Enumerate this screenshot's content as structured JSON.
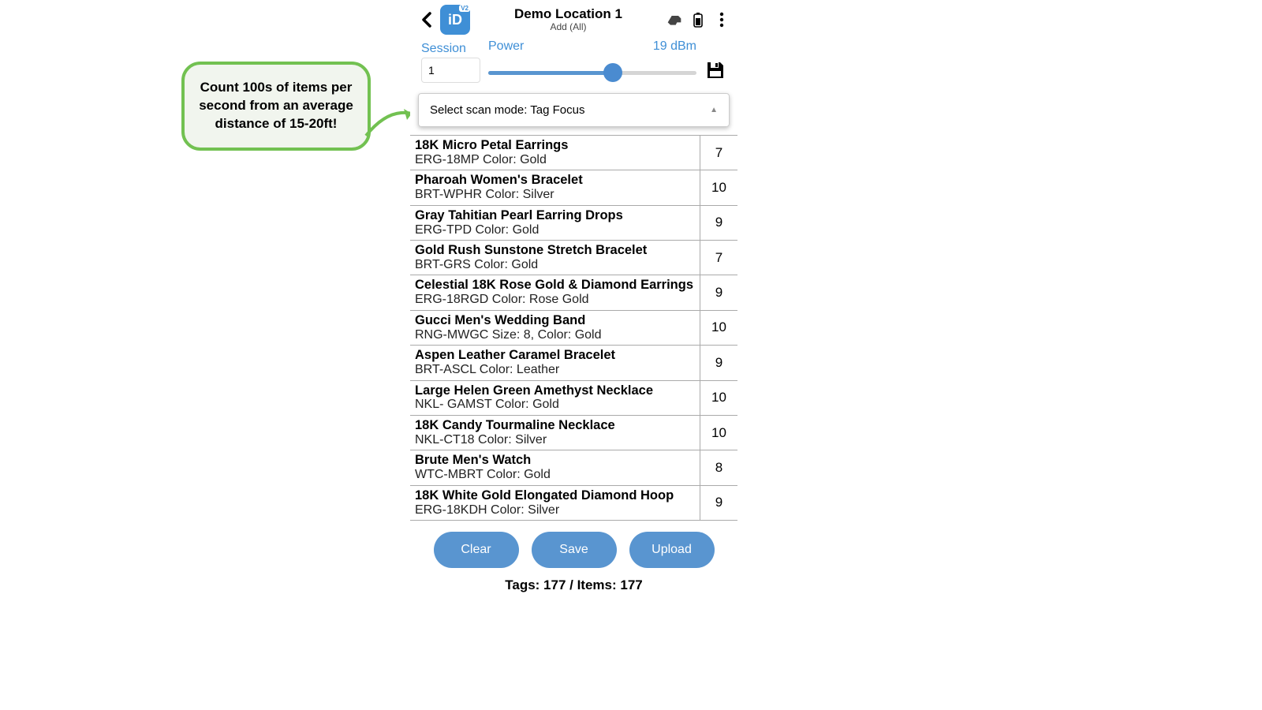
{
  "callout": {
    "text": "Count 100s of items per second from an average distance of 15-20ft!"
  },
  "header": {
    "title": "Demo Location 1",
    "subtitle": "Add (All)",
    "logo_text": "iD",
    "logo_badge": "V2"
  },
  "controls": {
    "session_label": "Session",
    "session_value": "1",
    "power_label": "Power",
    "power_value": "19 dBm",
    "slider_percent": 60
  },
  "dropdown": {
    "label_prefix": "Select scan mode:  ",
    "value": "Tag Focus"
  },
  "items": [
    {
      "name": "18K Micro Petal Earrings",
      "sub": "ERG-18MP Color: Gold",
      "count": 7
    },
    {
      "name": "Pharoah Women's Bracelet",
      "sub": "BRT-WPHR Color: Silver",
      "count": 10
    },
    {
      "name": "Gray Tahitian Pearl Earring Drops",
      "sub": "ERG-TPD Color: Gold",
      "count": 9
    },
    {
      "name": "Gold Rush Sunstone Stretch Bracelet",
      "sub": "BRT-GRS Color: Gold",
      "count": 7
    },
    {
      "name": "Celestial 18K Rose Gold & Diamond Earrings",
      "sub": "ERG-18RGD Color: Rose Gold",
      "count": 9
    },
    {
      "name": "Gucci Men's Wedding Band",
      "sub": "RNG-MWGC Size: 8, Color: Gold",
      "count": 10
    },
    {
      "name": "Aspen Leather Caramel Bracelet",
      "sub": "BRT-ASCL Color: Leather",
      "count": 9
    },
    {
      "name": "Large Helen Green Amethyst Necklace",
      "sub": "NKL- GAMST Color: Gold",
      "count": 10
    },
    {
      "name": "18K Candy Tourmaline Necklace",
      "sub": "NKL-CT18 Color: Silver",
      "count": 10
    },
    {
      "name": "Brute Men's Watch",
      "sub": "WTC-MBRT Color: Gold",
      "count": 8
    },
    {
      "name": "18K White Gold Elongated Diamond Hoop",
      "sub": "ERG-18KDH Color: Silver",
      "count": 9
    }
  ],
  "buttons": {
    "clear": "Clear",
    "save": "Save",
    "upload": "Upload"
  },
  "footer": {
    "stats": "Tags: 177 / Items: 177"
  }
}
